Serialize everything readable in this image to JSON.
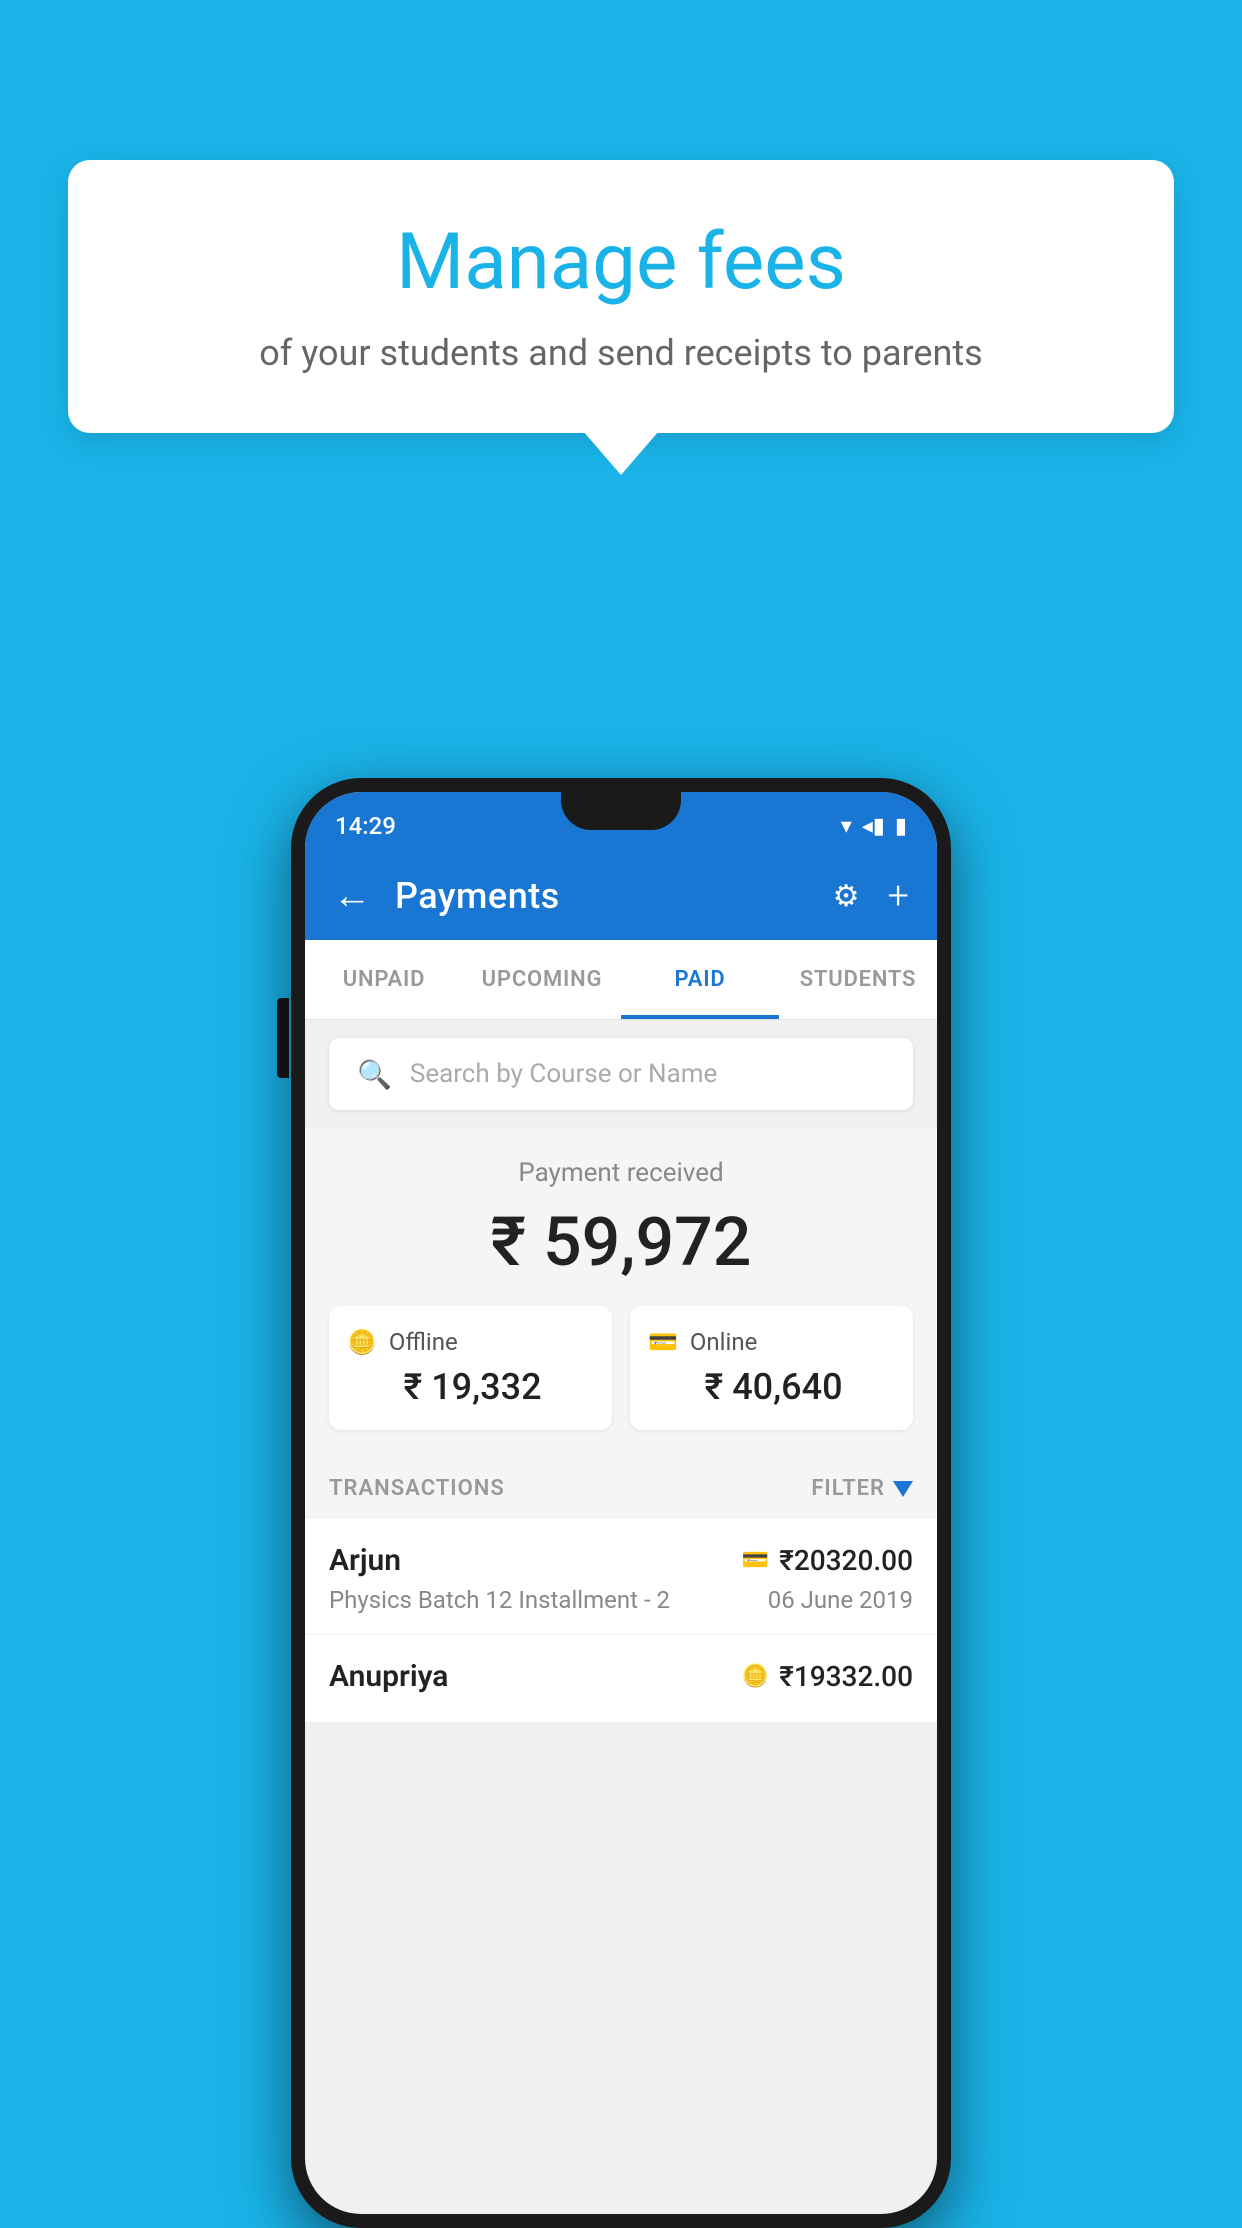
{
  "page": {
    "background_color": "#1ab3e8"
  },
  "tooltip": {
    "title": "Manage fees",
    "subtitle": "of your students and send receipts to parents"
  },
  "status_bar": {
    "time": "14:29",
    "signal_icon": "▼◀▮",
    "wifi_icon": "▼",
    "signal_bars": "◀",
    "battery": "▮"
  },
  "app_bar": {
    "back_icon": "←",
    "title": "Payments",
    "settings_icon": "⚙",
    "add_icon": "+"
  },
  "tabs": [
    {
      "id": "unpaid",
      "label": "UNPAID",
      "active": false
    },
    {
      "id": "upcoming",
      "label": "UPCOMING",
      "active": false
    },
    {
      "id": "paid",
      "label": "PAID",
      "active": true
    },
    {
      "id": "students",
      "label": "STUDENTS",
      "active": false
    }
  ],
  "search": {
    "placeholder": "Search by Course or Name",
    "icon": "🔍"
  },
  "payment_summary": {
    "label": "Payment received",
    "total": "₹ 59,972",
    "offline": {
      "label": "Offline",
      "amount": "₹ 19,332"
    },
    "online": {
      "label": "Online",
      "amount": "₹ 40,640"
    }
  },
  "transactions": {
    "header_label": "TRANSACTIONS",
    "filter_label": "FILTER",
    "items": [
      {
        "name": "Arjun",
        "course": "Physics Batch 12 Installment - 2",
        "date": "06 June 2019",
        "amount": "₹20320.00",
        "payment_type": "card"
      },
      {
        "name": "Anupriya",
        "course": "",
        "date": "",
        "amount": "₹19332.00",
        "payment_type": "cash"
      }
    ]
  }
}
